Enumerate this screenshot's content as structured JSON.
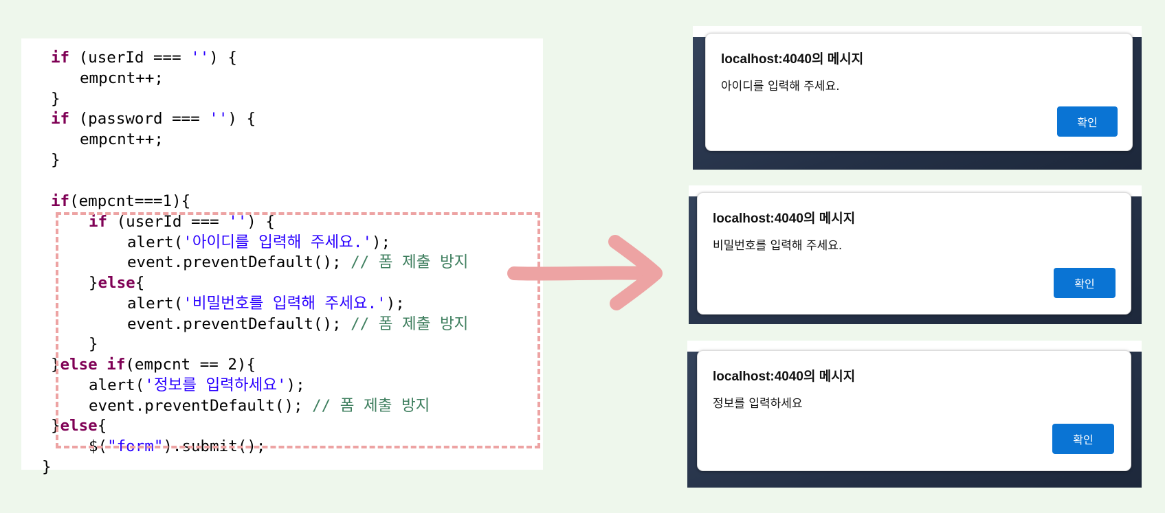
{
  "code": {
    "lines": [
      [
        [
          "kw",
          "if"
        ],
        [
          "txt",
          " (userId === "
        ],
        [
          "str",
          "''"
        ],
        [
          "txt",
          ") {"
        ]
      ],
      [
        [
          "txt",
          "empcnt++;"
        ]
      ],
      [
        [
          "txt",
          "}"
        ]
      ],
      [
        [
          "kw",
          "if"
        ],
        [
          "txt",
          " (password === "
        ],
        [
          "str",
          "''"
        ],
        [
          "txt",
          ") {"
        ]
      ],
      [
        [
          "txt",
          "empcnt++;"
        ]
      ],
      [
        [
          "txt",
          "}"
        ]
      ],
      [
        [
          "kw",
          "if"
        ],
        [
          "txt",
          "(empcnt===1){"
        ]
      ],
      [
        [
          "kw",
          "if"
        ],
        [
          "txt",
          " (userId === "
        ],
        [
          "str",
          "''"
        ],
        [
          "txt",
          ") {"
        ]
      ],
      [
        [
          "txt",
          "alert("
        ],
        [
          "str",
          "'아이디를 입력해 주세요.'"
        ],
        [
          "txt",
          ");"
        ]
      ],
      [
        [
          "txt",
          "event.preventDefault(); "
        ],
        [
          "com",
          "// 폼 제출 방지"
        ]
      ],
      [
        [
          "txt",
          "}"
        ],
        [
          "kw",
          "else"
        ],
        [
          "txt",
          "{"
        ]
      ],
      [
        [
          "txt",
          "alert("
        ],
        [
          "str",
          "'비밀번호를 입력해 주세요.'"
        ],
        [
          "txt",
          ");"
        ]
      ],
      [
        [
          "txt",
          "event.preventDefault(); "
        ],
        [
          "com",
          "// 폼 제출 방지"
        ]
      ],
      [
        [
          "txt",
          "}"
        ]
      ],
      [
        [
          "txt",
          "}"
        ],
        [
          "kw",
          "else if"
        ],
        [
          "txt",
          "(empcnt == 2){"
        ]
      ],
      [
        [
          "txt",
          "alert("
        ],
        [
          "str",
          "'정보를 입력하세요'"
        ],
        [
          "txt",
          ");"
        ]
      ],
      [
        [
          "txt",
          "event.preventDefault(); "
        ],
        [
          "com",
          "// 폼 제출 방지"
        ]
      ],
      [
        [
          "txt",
          "}"
        ],
        [
          "kw",
          "else"
        ],
        [
          "txt",
          "{"
        ]
      ],
      [
        [
          "txt",
          "$("
        ],
        [
          "str",
          "\"form\""
        ],
        [
          "txt",
          ").submit();"
        ]
      ],
      [
        [
          "txt",
          "}"
        ]
      ]
    ]
  },
  "dialogs": [
    {
      "title": "localhost:4040의 메시지",
      "message": "아이디를 입력해 주세요.",
      "ok_label": "확인"
    },
    {
      "title": "localhost:4040의 메시지",
      "message": "비밀번호를 입력해 주세요.",
      "ok_label": "확인"
    },
    {
      "title": "localhost:4040의 메시지",
      "message": "정보를 입력하세요",
      "ok_label": "확인"
    }
  ],
  "colors": {
    "page_background": "#eef7ec",
    "keyword": "#7f0055",
    "string": "#2a00ff",
    "comment": "#3f7f5f",
    "highlight_dash": "#eda3a3",
    "arrow": "#eda3a3",
    "ok_button": "#0a74d4"
  }
}
